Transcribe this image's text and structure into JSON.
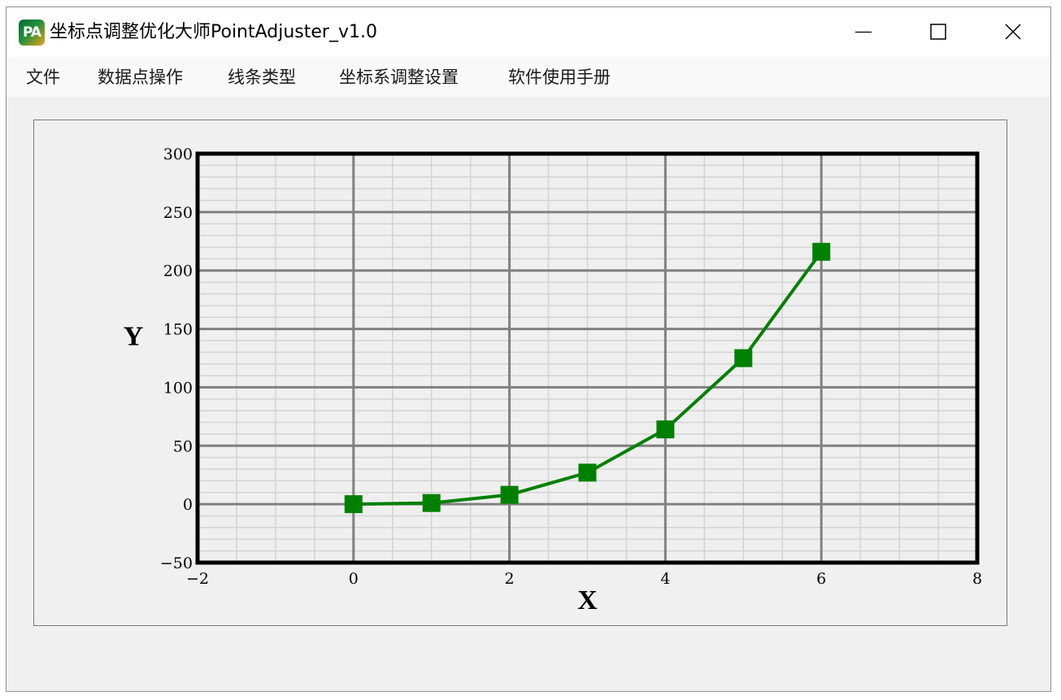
{
  "window": {
    "title": "坐标点调整优化大师PointAdjuster_v1.0",
    "icon_text": "PA",
    "controls": {
      "minimize": "minimize-icon",
      "maximize": "maximize-icon",
      "close": "close-icon"
    }
  },
  "menu": {
    "items": [
      {
        "label": "文件"
      },
      {
        "label": "数据点操作"
      },
      {
        "label": "线条类型"
      },
      {
        "label": "坐标系调整设置"
      },
      {
        "label": "软件使用手册"
      }
    ]
  },
  "colors": {
    "series": "#008000",
    "major_grid": "#808080",
    "minor_grid": "#d3d3d3",
    "axes_box": "#000000",
    "plot_bg": "#efefef"
  },
  "chart_data": {
    "type": "line",
    "xlabel": "X",
    "ylabel": "Y",
    "xlim": [
      -2,
      8
    ],
    "ylim": [
      -50,
      300
    ],
    "xticks": [
      -2,
      0,
      2,
      4,
      6,
      8
    ],
    "yticks": [
      -50,
      0,
      50,
      100,
      150,
      200,
      250,
      300
    ],
    "xtick_labels": [
      "−2",
      "0",
      "2",
      "4",
      "6",
      "8"
    ],
    "ytick_labels": [
      "−50",
      "0",
      "50",
      "100",
      "150",
      "200",
      "250",
      "300"
    ],
    "grid": true,
    "marker": "square",
    "series": [
      {
        "x": [
          0,
          1,
          2,
          3,
          4,
          5,
          6
        ],
        "y": [
          0,
          1,
          8,
          27,
          64,
          125,
          216
        ]
      }
    ]
  }
}
